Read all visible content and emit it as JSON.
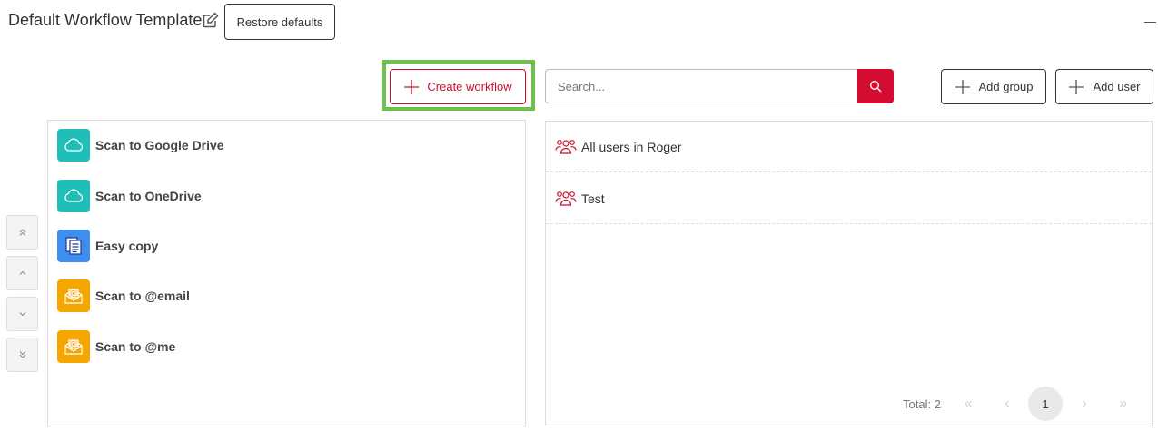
{
  "header": {
    "title": "Default Workflow Template",
    "restore_label": "Restore defaults"
  },
  "toolbar": {
    "create_workflow_label": "Create workflow",
    "search_placeholder": "Search...",
    "add_group_label": "Add group",
    "add_user_label": "Add user"
  },
  "workflows": [
    {
      "label": "Scan to Google Drive",
      "icon": "cloud-icon",
      "color": "#1fbfb8"
    },
    {
      "label": "Scan to OneDrive",
      "icon": "cloud-icon",
      "color": "#1fbfb8"
    },
    {
      "label": "Easy copy",
      "icon": "copy-document-icon",
      "color": "#3d8ef0"
    },
    {
      "label": "Scan to @email",
      "icon": "email-envelope-icon",
      "color": "#f5a600"
    },
    {
      "label": "Scan to @me",
      "icon": "email-envelope-icon",
      "color": "#f5a600"
    }
  ],
  "users": [
    {
      "label": "All users in Roger",
      "icon": "group-icon"
    },
    {
      "label": "Test",
      "icon": "group-icon"
    }
  ],
  "pagination": {
    "total_label": "Total: 2",
    "current_page": "1"
  },
  "colors": {
    "accent": "#d40c2f",
    "highlight": "#6cc24a"
  }
}
